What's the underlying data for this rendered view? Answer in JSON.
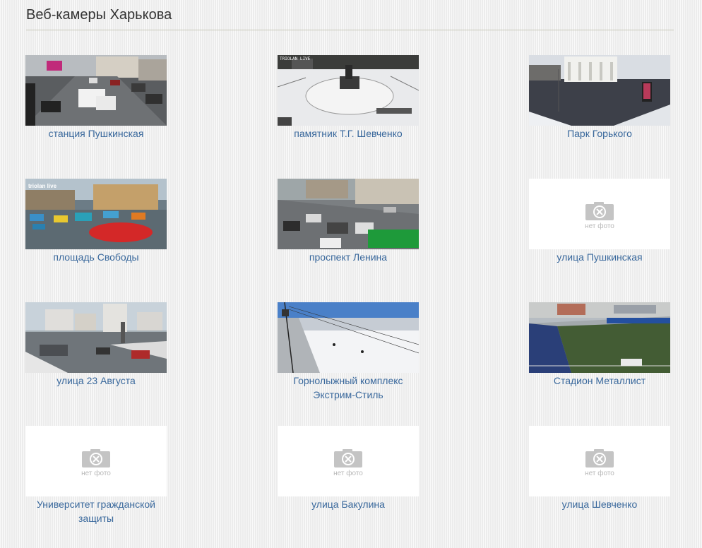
{
  "page": {
    "title": "Веб-камеры Харькова"
  },
  "no_photo_label": "нет фото",
  "cameras": [
    {
      "caption": "станция Пушкинская",
      "has_photo": true
    },
    {
      "caption": "памятник Т.Г. Шевченко",
      "has_photo": true,
      "overlay": "TRIOLAN LIVE"
    },
    {
      "caption": "Парк Горького",
      "has_photo": true
    },
    {
      "caption": "площадь Свободы",
      "has_photo": true,
      "overlay": "triolan live"
    },
    {
      "caption": "проспект Ленина",
      "has_photo": true
    },
    {
      "caption": "улица Пушкинская",
      "has_photo": false
    },
    {
      "caption": "улица 23 Августа",
      "has_photo": true
    },
    {
      "caption": "Горнолыжный комплекс Экстрим-Стиль",
      "has_photo": true
    },
    {
      "caption": "Стадион Металлист",
      "has_photo": true
    },
    {
      "caption": "Университет гражданской защиты",
      "has_photo": false
    },
    {
      "caption": "улица Бакулина",
      "has_photo": false
    },
    {
      "caption": "улица Шевченко",
      "has_photo": false
    }
  ],
  "colors": {
    "link": "#39689c",
    "title": "#333333",
    "rule": "#c9c9b9"
  }
}
